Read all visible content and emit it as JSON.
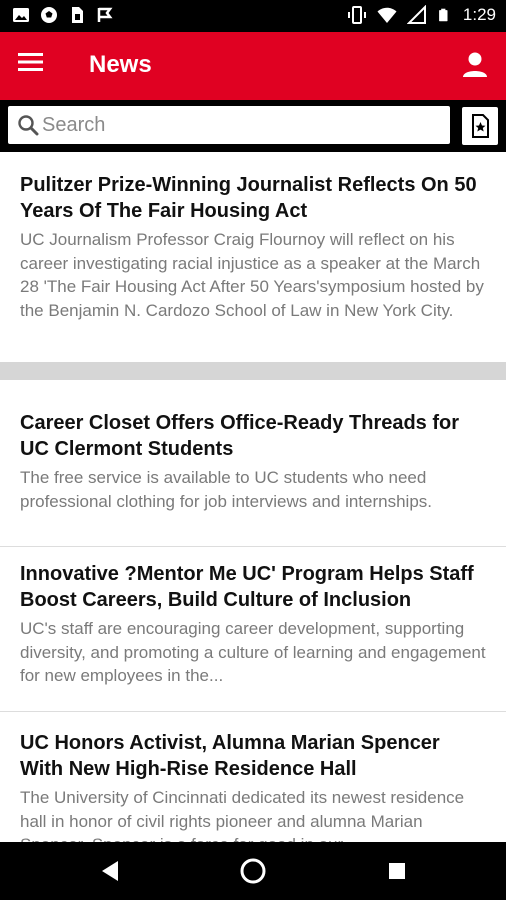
{
  "status_bar": {
    "time": "1:29",
    "icons": [
      "image-icon",
      "soccer-ball-icon",
      "sim-card-icon",
      "flag-icon",
      "vibrate-icon",
      "wifi-icon",
      "no-signal-icon",
      "battery-icon"
    ]
  },
  "app_bar": {
    "title": "News",
    "menu_icon": "hamburger-menu-icon",
    "profile_icon": "person-icon",
    "color": "#e00122"
  },
  "search": {
    "placeholder": "Search",
    "value": "",
    "saved_icon": "bookmark-star-icon"
  },
  "news_items": [
    {
      "title": "Pulitzer Prize-Winning Journalist Reflects On 50 Years Of The Fair Housing Act",
      "summary": "UC Journalism Professor Craig Flournoy will reflect on his career investigating racial injustice as a speaker at the March 28 'The Fair Housing Act After 50 Years'symposium hosted by the Benjamin N. Cardozo School of Law in New York City."
    },
    {
      "title": "Career Closet Offers Office-Ready Threads for UC Clermont Students",
      "summary": "The free service is available to UC students who need professional clothing for job interviews and internships."
    },
    {
      "title": "Innovative ?Mentor Me UC' Program Helps Staff Boost Careers, Build Culture of Inclusion",
      "summary": "UC's staff are encouraging career development, supporting diversity, and promoting a culture of learning and engagement for new employees in the..."
    },
    {
      "title": "UC Honors Activist, Alumna Marian Spencer With New High-Rise Residence Hall",
      "summary": "The University of Cincinnati dedicated its newest residence hall in honor of civil rights pioneer and alumna Marian Spencer. Spencer is a force for good in our..."
    }
  ],
  "nav_bar": {
    "icons": [
      "back-icon",
      "home-icon",
      "recents-icon"
    ]
  }
}
